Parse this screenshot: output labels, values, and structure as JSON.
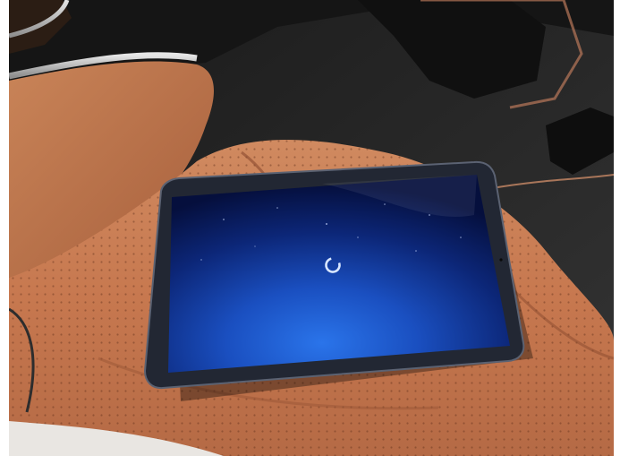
{
  "image": {
    "kind": "photograph",
    "subject": "tablet-on-car-seat",
    "colors": {
      "leather": "#c7784f",
      "leather_shadow": "#8a4a2e",
      "carpet": "#2a2a2a",
      "screen_deep": "#07185a",
      "screen_glow": "#1e5fd6",
      "spinner": "#d8e6ff"
    },
    "icons": [
      "loading-spinner-icon"
    ]
  }
}
